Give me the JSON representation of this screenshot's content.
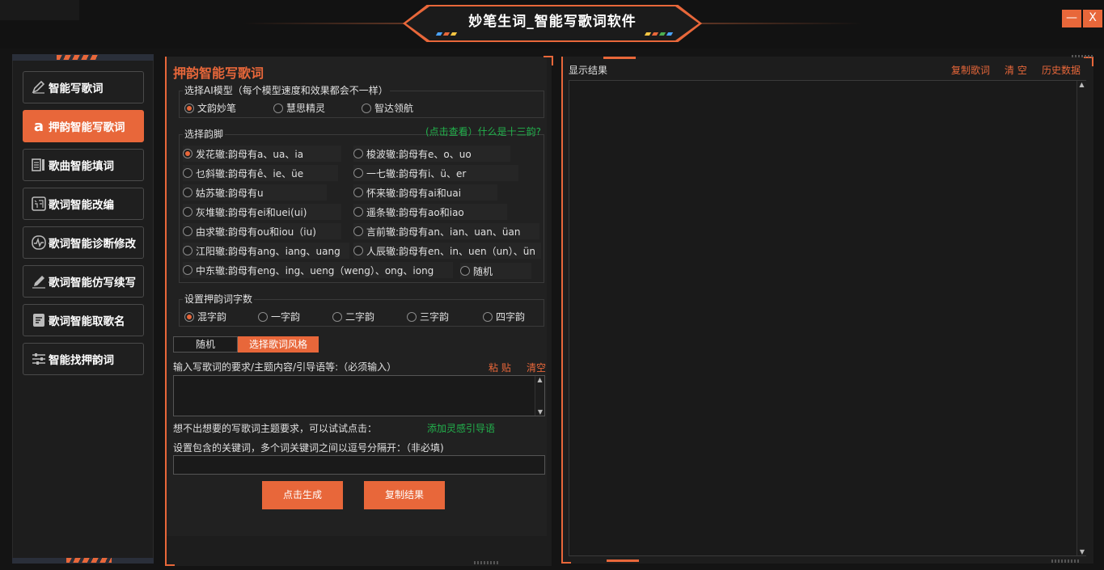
{
  "window": {
    "title": "妙笔生词_智能写歌词软件",
    "minimize_label": "—",
    "close_label": "X"
  },
  "sidebar": {
    "items": [
      {
        "label": "智能写歌词",
        "icon": "pen-icon"
      },
      {
        "label": "押韵智能写歌词",
        "icon": "letter-a-icon",
        "active": true
      },
      {
        "label": "歌曲智能填词",
        "icon": "list-icon"
      },
      {
        "label": "歌词智能改编",
        "icon": "ci-character-icon"
      },
      {
        "label": "歌词智能诊断修改",
        "icon": "pulse-icon"
      },
      {
        "label": "歌词智能仿写续写",
        "icon": "pencil-icon"
      },
      {
        "label": "歌词智能取歌名",
        "icon": "document-icon"
      },
      {
        "label": "智能找押韵词",
        "icon": "sliders-icon"
      }
    ]
  },
  "main": {
    "heading": "押韵智能写歌词",
    "model_section": {
      "legend": "选择AI模型（每个模型速度和效果都会不一样）",
      "options": [
        "文韵妙笔",
        "慧思精灵",
        "智达领航"
      ],
      "selected": "文韵妙笔"
    },
    "rhyme_section": {
      "legend": "选择韵脚",
      "help_link": "(点击查看）什么是十三韵?",
      "options": [
        "发花辙:韵母有a、ua、ia",
        "梭波辙:韵母有e、o、uo",
        "乜斜辙:韵母有ê、ie、üe",
        "一七辙:韵母有i、ü、er",
        "姑苏辙:韵母有u",
        "怀来辙:韵母有ai和uai",
        "灰堆辙:韵母有ei和uei(ui)",
        "遥条辙:韵母有ao和iao",
        "由求辙:韵母有ou和iou（iu)",
        "言前辙:韵母有an、ian、uan、üan",
        "江阳辙:韵母有ang、iang、uang",
        "人辰辙:韵母有en、in、uen（un）、ün",
        "中东辙:韵母有eng、ing、ueng（weng）、ong、iong",
        "随机"
      ],
      "selected": "发花辙:韵母有a、ua、ia"
    },
    "count_section": {
      "legend": "设置押韵词字数",
      "options": [
        "混字韵",
        "一字韵",
        "二字韵",
        "三字韵",
        "四字韵"
      ],
      "selected": "混字韵"
    },
    "style": {
      "value": "随机",
      "button": "选择歌词风格"
    },
    "prompt": {
      "label": "输入写歌词的要求/主题内容/引导语等:（必须输入）",
      "paste": "粘 贴",
      "clear": "清空",
      "value": ""
    },
    "inspire": {
      "label": "想不出想要的写歌词主题要求，可以试试点击：",
      "link": "添加灵感引导语"
    },
    "keywords": {
      "label": "设置包含的关键词，多个词关键词之间以逗号分隔开：（非必填)",
      "value": ""
    },
    "actions": {
      "generate": "点击生成",
      "copy": "复制结果"
    }
  },
  "result": {
    "label": "显示结果",
    "copy": "复制歌词",
    "clear": "清 空",
    "history": "历史数据",
    "content": ""
  },
  "colors": {
    "accent": "#e8673a",
    "link_green": "#22b14c",
    "background": "#141414"
  }
}
